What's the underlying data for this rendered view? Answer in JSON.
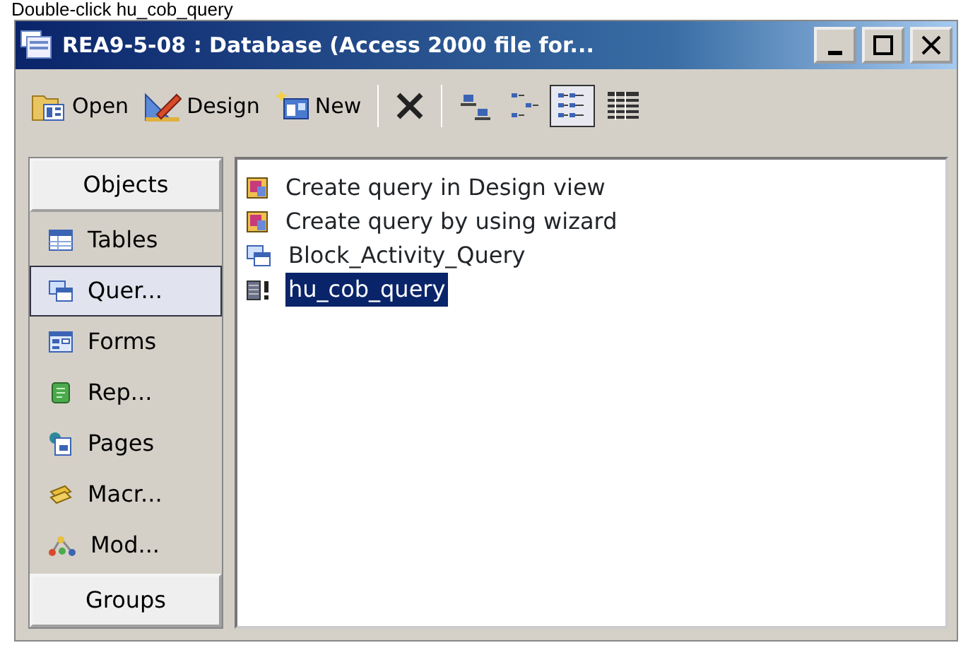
{
  "caption": "Double-click hu_cob_query",
  "window": {
    "title": "REA9-5-08 : Database (Access 2000 file for..."
  },
  "toolbar": [
    {
      "kind": "open",
      "label": "Open"
    },
    {
      "kind": "design",
      "label": "Design"
    },
    {
      "kind": "new",
      "label": "New"
    },
    {
      "kind": "delete"
    },
    {
      "kind": "large-icons",
      "selected": false
    },
    {
      "kind": "small-icons",
      "selected": false
    },
    {
      "kind": "list",
      "selected": true
    },
    {
      "kind": "details",
      "selected": false
    }
  ],
  "sidebar": {
    "header": "Objects",
    "footer": "Groups",
    "items": [
      {
        "kind": "table",
        "label": "Tables",
        "selected": false
      },
      {
        "kind": "query",
        "label": "Quer...",
        "selected": true
      },
      {
        "kind": "form",
        "label": "Forms",
        "selected": false
      },
      {
        "kind": "report",
        "label": "Rep...",
        "selected": false
      },
      {
        "kind": "page",
        "label": "Pages",
        "selected": false
      },
      {
        "kind": "macro",
        "label": "Macr...",
        "selected": false
      },
      {
        "kind": "module",
        "label": "Mod...",
        "selected": false
      }
    ]
  },
  "objects": [
    {
      "kind": "shortcut",
      "label": "Create query in Design view",
      "selected": false
    },
    {
      "kind": "shortcut",
      "label": "Create query by using wizard",
      "selected": false
    },
    {
      "kind": "select-query",
      "label": "Block_Activity_Query",
      "selected": false
    },
    {
      "kind": "action-query",
      "label": "hu_cob_query",
      "selected": true
    }
  ]
}
